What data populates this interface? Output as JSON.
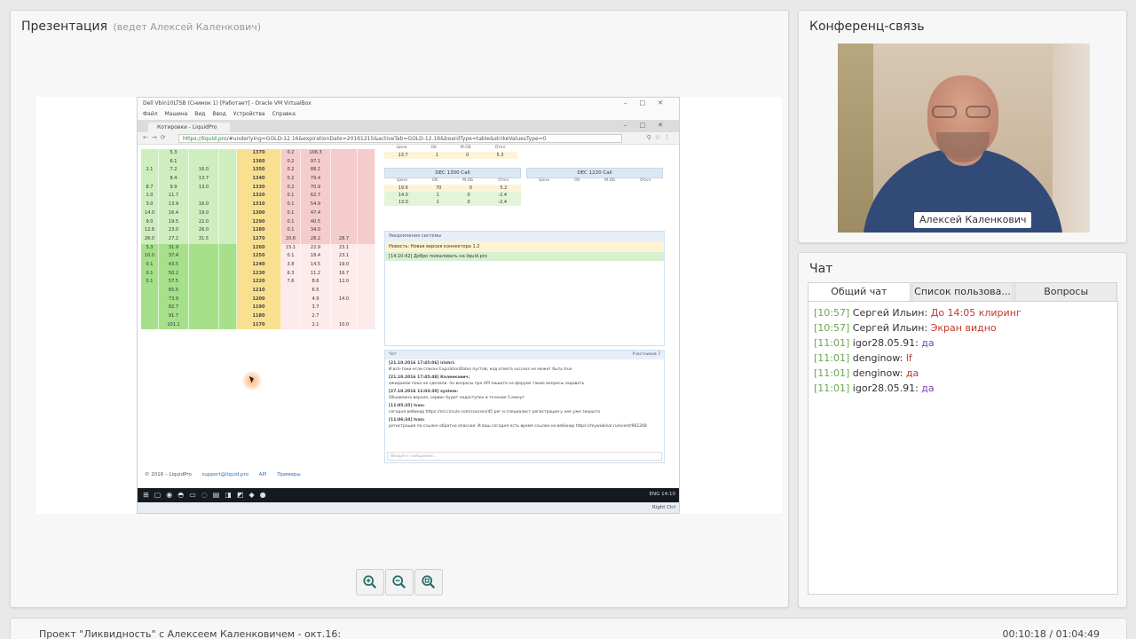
{
  "presentation": {
    "title": "Презентация",
    "presenter": "(ведет Алексей Каленкович)",
    "screenshot": {
      "vm_title": "Dell Vbin10LTSB (Снимок 1) [Работает] - Oracle VM VirtualBox",
      "vm_menu": [
        "Файл",
        "Машина",
        "Вид",
        "Ввод",
        "Устройства",
        "Справка"
      ],
      "tab_label": "Котировки - LiquidPro",
      "url_host": "https://liquid.pro",
      "url_path": "/#underlying=GOLD-12.16&expirationDate=20161215&activeTab=GOLD-12.16&boardType=table&strikeValuesType=0",
      "board_rows": [
        {
          "a": "",
          "b": "5.3",
          "c": "",
          "d": "",
          "s": "1370",
          "f": "0.2",
          "g": "106.3",
          "h": "",
          "i": "",
          "tone": "top"
        },
        {
          "a": "",
          "b": "6.1",
          "c": "",
          "d": "",
          "s": "1360",
          "f": "0.2",
          "g": "97.1",
          "h": "",
          "i": "",
          "tone": "top"
        },
        {
          "a": "2.1",
          "b": "7.2",
          "c": "16.0",
          "d": "",
          "s": "1350",
          "f": "0.2",
          "g": "88.2",
          "h": "",
          "i": "",
          "tone": "top"
        },
        {
          "a": "",
          "b": "8.4",
          "c": "13.7",
          "d": "",
          "s": "1340",
          "f": "0.2",
          "g": "79.4",
          "h": "",
          "i": "",
          "tone": "top"
        },
        {
          "a": "8.7",
          "b": "9.9",
          "c": "13.0",
          "d": "",
          "s": "1330",
          "f": "0.2",
          "g": "70.9",
          "h": "",
          "i": "",
          "tone": "top"
        },
        {
          "a": "1.0",
          "b": "11.7",
          "c": "",
          "d": "",
          "s": "1320",
          "f": "0.1",
          "g": "62.7",
          "h": "",
          "i": "",
          "tone": "top"
        },
        {
          "a": "3.0",
          "b": "13.9",
          "c": "16.0",
          "d": "",
          "s": "1310",
          "f": "0.1",
          "g": "54.9",
          "h": "",
          "i": "",
          "tone": "top"
        },
        {
          "a": "14.0",
          "b": "16.4",
          "c": "19.0",
          "d": "",
          "s": "1300",
          "f": "0.1",
          "g": "47.4",
          "h": "",
          "i": "",
          "tone": "top"
        },
        {
          "a": "9.0",
          "b": "19.5",
          "c": "22.0",
          "d": "",
          "s": "1290",
          "f": "0.1",
          "g": "40.5",
          "h": "",
          "i": "",
          "tone": "top"
        },
        {
          "a": "12.8",
          "b": "23.0",
          "c": "26.0",
          "d": "",
          "s": "1280",
          "f": "0.1",
          "g": "34.0",
          "h": "",
          "i": "",
          "tone": "top"
        },
        {
          "a": "26.0",
          "b": "27.2",
          "c": "31.5",
          "d": "",
          "s": "1270",
          "f": "20.6",
          "g": "28.2",
          "h": "28.7",
          "i": "",
          "tone": "top"
        },
        {
          "a": "5.3",
          "b": "31.9",
          "c": "",
          "d": "",
          "s": "1260",
          "f": "15.1",
          "g": "22.9",
          "h": "23.1",
          "i": "",
          "tone": "bottom"
        },
        {
          "a": "10.0",
          "b": "37.4",
          "c": "",
          "d": "",
          "s": "1250",
          "f": "0.1",
          "g": "18.4",
          "h": "23.1",
          "i": "",
          "tone": "bottom"
        },
        {
          "a": "0.1",
          "b": "43.5",
          "c": "",
          "d": "",
          "s": "1240",
          "f": "3.8",
          "g": "14.5",
          "h": "19.0",
          "i": "",
          "tone": "bottom"
        },
        {
          "a": "0.1",
          "b": "50.2",
          "c": "",
          "d": "",
          "s": "1230",
          "f": "6.3",
          "g": "11.2",
          "h": "16.7",
          "i": "",
          "tone": "bottom"
        },
        {
          "a": "0.1",
          "b": "57.5",
          "c": "",
          "d": "",
          "s": "1220",
          "f": "7.6",
          "g": "8.6",
          "h": "12.0",
          "i": "",
          "tone": "bottom"
        },
        {
          "a": "",
          "b": "65.5",
          "c": "",
          "d": "",
          "s": "1210",
          "f": "",
          "g": "6.5",
          "h": "",
          "i": "",
          "tone": "bottom"
        },
        {
          "a": "",
          "b": "73.9",
          "c": "",
          "d": "",
          "s": "1200",
          "f": "",
          "g": "4.9",
          "h": "14.0",
          "i": "",
          "tone": "bottom"
        },
        {
          "a": "",
          "b": "82.7",
          "c": "",
          "d": "",
          "s": "1190",
          "f": "",
          "g": "3.7",
          "h": "",
          "i": "",
          "tone": "bottom"
        },
        {
          "a": "",
          "b": "91.7",
          "c": "",
          "d": "",
          "s": "1180",
          "f": "",
          "g": "2.7",
          "h": "",
          "i": "",
          "tone": "bottom"
        },
        {
          "a": "",
          "b": "101.1",
          "c": "",
          "d": "",
          "s": "1170",
          "f": "",
          "g": "2.1",
          "h": "10.0",
          "i": "",
          "tone": "bottom"
        }
      ],
      "card_header_cols": [
        "Цена",
        "Об",
        "М.ОБ",
        "Откл"
      ],
      "card_top_row": [
        "13.7",
        "1",
        "0",
        "5.3"
      ],
      "card1_title": "DEC 1300 Call",
      "card1_rows": [
        [
          "19.6",
          "70",
          "0",
          "5.2"
        ],
        [
          "14.0",
          "1",
          "0",
          "-2.4"
        ],
        [
          "13.0",
          "1",
          "0",
          "-2.4"
        ]
      ],
      "card2_title": "DEC 1220 Call",
      "notif_title": "Уведомления системы",
      "notif_1": "Новость: Новая версия коннектора 1.2",
      "notif_2": "[14:10:42] Добро пожаловать на liquid.pro",
      "chat_title": "Чат",
      "chat_users": "Участников 7",
      "chat_msgs": [
        {
          "h": "[21.10.2016 17:45:06] irishri:",
          "t": "И всё-таки если списке ExpirationDates пустой, код ответа success не может быть true"
        },
        {
          "h": "[21.10.2016 17:45:48] Каленкович:",
          "t": "ожидаемо пока не сделали. по вопросы про API пишите на форуме такие вопросы задавать"
        },
        {
          "h": "[27.10.2016 12:03:30] system:",
          "t": "Обновлена версия, сервис будет недоступен в течение 5 минут"
        },
        {
          "h": "[11:05:35] Ivan:",
          "t": "сегодня вебинар https://ssl.circule.com/courses/45 рег и специалист регистрация у нее уже закрыта"
        },
        {
          "h": "[11:06:34] Ivan:",
          "t": "регистрация по ссылке обратно опасная. И ваш сегодня есть время ссылка на вебинар https://mywebinar.ru/event/961268"
        }
      ],
      "chat_placeholder": "Введите сообщение...",
      "footer_copy": "© 2016 – LiquidPro",
      "footer_email": "support@liquid.pro",
      "footer_api": "API",
      "footer_examples": "Примеры",
      "tray_lang": "ENG",
      "tray_time": "14:10",
      "vbox_hostkey": "Right Ctrl"
    }
  },
  "conference": {
    "title": "Конференц-связь",
    "speaker": "Алексей Каленкович"
  },
  "chat": {
    "title": "Чат",
    "tabs": [
      "Общий чат",
      "Список пользова...",
      "Вопросы"
    ],
    "messages": [
      {
        "time": "[10:57]",
        "author": "Сергей Ильин:",
        "text": "До 14:05 клиринг",
        "tone": "red"
      },
      {
        "time": "[10:57]",
        "author": "Сергей Ильин:",
        "text": "Экран видно",
        "tone": "red"
      },
      {
        "time": "[11:01]",
        "author": "igor28.05.91:",
        "text": "да",
        "tone": "purple"
      },
      {
        "time": "[11:01]",
        "author": "denginow:",
        "text": "lf",
        "tone": "red"
      },
      {
        "time": "[11:01]",
        "author": "denginow:",
        "text": "да",
        "tone": "red"
      },
      {
        "time": "[11:01]",
        "author": "igor28.05.91:",
        "text": "да",
        "tone": "purple"
      }
    ]
  },
  "bottom": {
    "title": "Проект \"Ликвидность\" с Алексеем Каленковичем - окт.16:",
    "time": "00:10:18 / 01:04:49"
  },
  "icons": {
    "zoom_in": "zoom-in-icon",
    "zoom_out": "zoom-out-icon",
    "zoom_fit": "zoom-fit-icon"
  },
  "colors": {
    "timestamp": "#6aa84f",
    "message_red": "#c0392b",
    "message_purple": "#7b3fb2"
  }
}
